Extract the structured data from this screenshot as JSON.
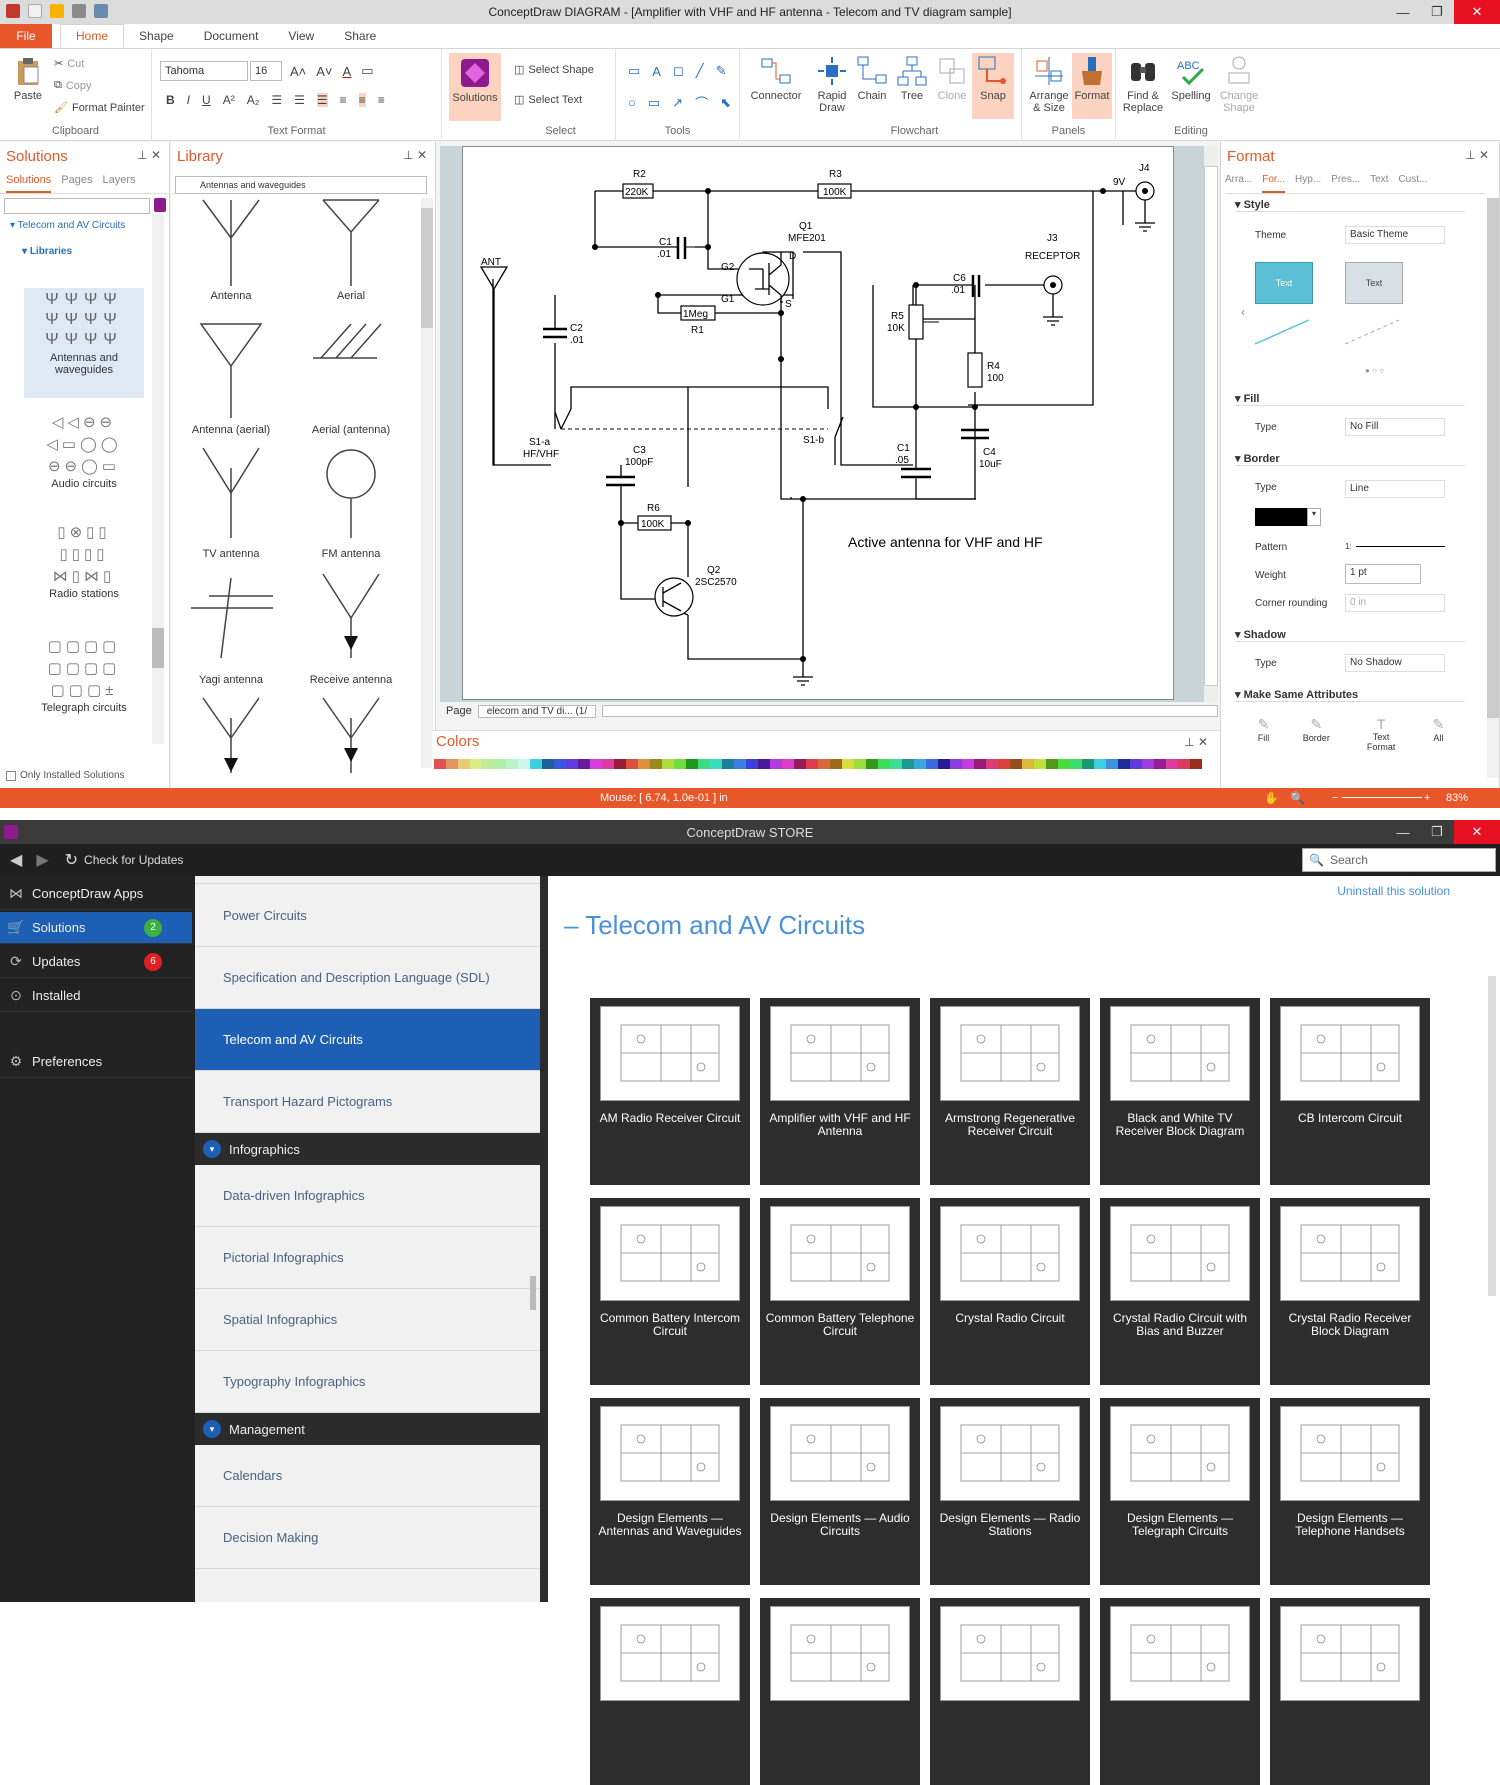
{
  "diagram_window": {
    "title": "ConceptDraw DIAGRAM - [Amplifier with VHF and HF antenna - Telecom and TV diagram sample]",
    "menu": {
      "file": "File",
      "tabs": [
        "Home",
        "Shape",
        "Document",
        "View",
        "Share"
      ]
    },
    "ribbon": {
      "clipboard": {
        "label": "Clipboard",
        "paste": "Paste",
        "cut": "Cut",
        "copy": "Copy",
        "format_painter": "Format Painter"
      },
      "text_format": {
        "label": "Text Format",
        "font": "Tahoma",
        "size": "16"
      },
      "solutions": "Solutions",
      "select": {
        "label": "Select",
        "select_shape": "Select Shape",
        "select_text": "Select Text"
      },
      "tools": {
        "label": "Tools"
      },
      "connector": "Connector",
      "flowchart": {
        "label": "Flowchart",
        "rapid_draw": "Rapid Draw",
        "chain": "Chain",
        "tree": "Tree",
        "clone": "Clone",
        "snap": "Snap"
      },
      "panels": {
        "label": "Panels",
        "arrange": "Arrange & Size",
        "format": "Format"
      },
      "editing": {
        "label": "Editing",
        "find": "Find & Replace",
        "spelling": "Spelling",
        "change_shape": "Change Shape"
      }
    },
    "solutions_panel": {
      "title": "Solutions",
      "tabs": [
        "Solutions",
        "Pages",
        "Layers"
      ],
      "tree_root": "Telecom and AV Circuits",
      "tree_child": "Libraries",
      "libraries": [
        "Antennas and waveguides",
        "Audio circuits",
        "Radio stations",
        "Telegraph circuits"
      ],
      "only_installed": "Only Installed Solutions"
    },
    "library_panel": {
      "title": "Library",
      "dropdown": "Antennas and waveguides",
      "items": [
        "Antenna",
        "Aerial",
        "Antenna (aerial)",
        "Aerial (antenna)",
        "TV antenna",
        "FM antenna",
        "Yagi antenna",
        "Receive antenna"
      ]
    },
    "diagram": {
      "caption": "Active antenna for VHF and HF",
      "labels": {
        "R2": "R2",
        "R2v": "220K",
        "R3": "R3",
        "R3v": "100K",
        "J4": "J4",
        "V9": "9V",
        "Q1": "Q1",
        "Q1v": "MFE201",
        "C1": "C1",
        "C1v": ".01",
        "G2": "G2",
        "D": "D",
        "G1": "G1",
        "S": "S",
        "J3": "J3",
        "RECEPTOR": "RECEPTOR",
        "ANT": "ANT",
        "C6": "C6",
        "C6v": ".01",
        "R1v": "1Meg",
        "R1": "R1",
        "C2": "C2",
        "C2v": ".01",
        "R5": "R5",
        "R5v": "10K",
        "R4": "R4",
        "R4v": "100",
        "S1a": "S1-a",
        "S1av": "HF/VHF",
        "S1b": "S1-b",
        "C3": "C3",
        "C3v": "100pF",
        "C1b": "C1",
        "C1bv": ".05",
        "C4": "C4",
        "C4v": "10uF",
        "R6": "R6",
        "R6v": "100K",
        "Q2": "Q2",
        "Q2v": "2SC2570"
      }
    },
    "page_tab": {
      "label": "Page",
      "tab": "elecom and TV di... (1/"
    },
    "colors_panel": {
      "title": "Colors"
    },
    "format_panel": {
      "title": "Format",
      "tabs": [
        "Arra...",
        "For...",
        "Hyp...",
        "Pres...",
        "Text",
        "Cust..."
      ],
      "style": "Style",
      "theme_label": "Theme",
      "theme_value": "Basic Theme",
      "swatch_text": "Text",
      "fill": "Fill",
      "fill_type_label": "Type",
      "fill_type": "No Fill",
      "border": "Border",
      "border_type_label": "Type",
      "border_type": "Line",
      "pattern_label": "Pattern",
      "pattern_value": "1:",
      "weight_label": "Weight",
      "weight_value": "1 pt",
      "corner_label": "Corner rounding",
      "corner_value": "0 in",
      "shadow": "Shadow",
      "shadow_type_label": "Type",
      "shadow_type": "No Shadow",
      "make_same": "Make Same Attributes",
      "make_same_items": [
        "Fill",
        "Border",
        "Text Format",
        "All"
      ]
    },
    "status": {
      "mouse": "Mouse: [ 6.74, 1.0e-01 ] in",
      "zoom": "83%"
    }
  },
  "store_window": {
    "title": "ConceptDraw STORE",
    "check_updates": "Check for Updates",
    "search_placeholder": "Search",
    "nav": [
      {
        "label": "ConceptDraw Apps"
      },
      {
        "label": "Solutions",
        "badge": "2"
      },
      {
        "label": "Updates",
        "badge": "6"
      },
      {
        "label": "Installed"
      },
      {
        "label": "Preferences"
      }
    ],
    "list": {
      "items1": [
        "Power Circuits",
        "Specification and Description Language (SDL)",
        "Telecom and AV Circuits",
        "Transport Hazard Pictograms"
      ],
      "cat1": "Infographics",
      "items2": [
        "Data-driven Infographics",
        "Pictorial Infographics",
        "Spatial Infographics",
        "Typography Infographics"
      ],
      "cat2": "Management",
      "items3": [
        "Calendars",
        "Decision Making"
      ]
    },
    "uninstall": "Uninstall this solution",
    "heading": "– Telecom and AV Circuits",
    "tiles": [
      "AM Radio Receiver Circuit",
      "Amplifier with VHF and HF Antenna",
      "Armstrong Regenerative Receiver Circuit",
      "Black and White TV Receiver Block Diagram",
      "CB Intercom Circuit",
      "Common Battery Intercom Circuit",
      "Common Battery Telephone Circuit",
      "Crystal Radio Circuit",
      "Crystal Radio Circuit with Bias and Buzzer",
      "Crystal Radio Receiver Block Diagram",
      "Design Elements — Antennas and Waveguides",
      "Design Elements — Audio Circuits",
      "Design Elements — Radio Stations",
      "Design Elements — Telegraph Circuits",
      "Design Elements — Telephone Handsets"
    ]
  }
}
